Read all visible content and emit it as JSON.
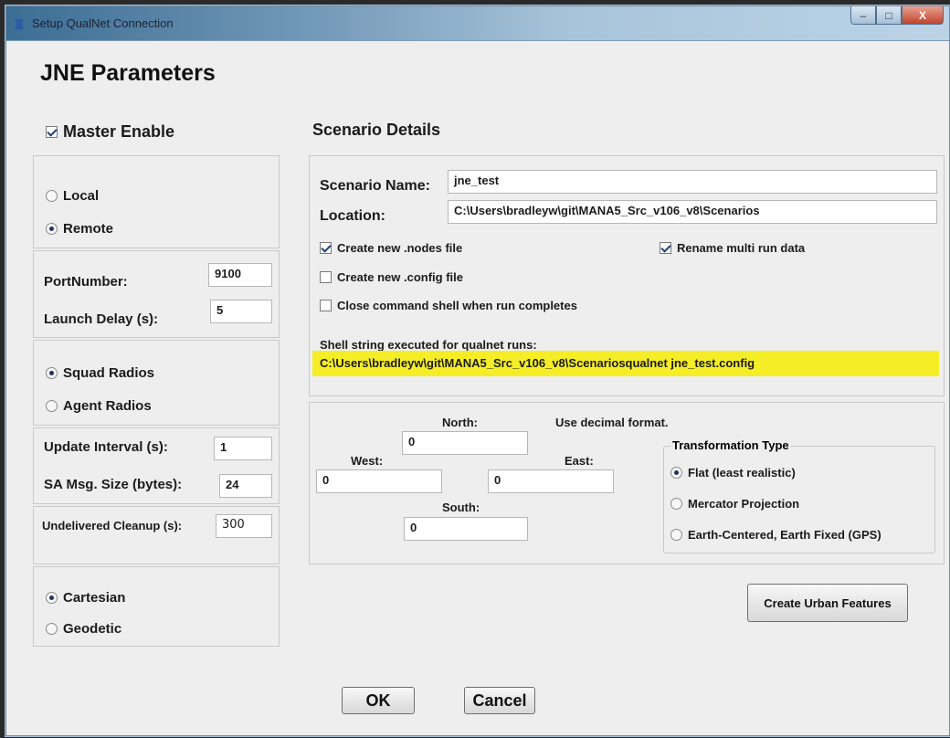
{
  "window": {
    "title": "Setup QualNet Connection",
    "min": "–",
    "max": "□",
    "close": "X"
  },
  "heading": "JNE Parameters",
  "left": {
    "master_enable": {
      "label": "Master Enable",
      "checked": true
    },
    "local": "Local",
    "remote": "Remote",
    "port_number": {
      "label": "PortNumber:",
      "value": "9100"
    },
    "launch_delay": {
      "label": "Launch Delay (s):",
      "value": "5"
    },
    "squad_radios": "Squad Radios",
    "agent_radios": "Agent Radios",
    "update_interval": {
      "label": "Update Interval (s):",
      "value": "1"
    },
    "sa_msg_size": {
      "label": "SA Msg. Size (bytes):",
      "value": "24"
    },
    "undelivered_cleanup": {
      "label": "Undelivered Cleanup (s):",
      "value": "300"
    },
    "cartesian": "Cartesian",
    "geodetic": "Geodetic"
  },
  "scenario": {
    "title": "Scenario Details",
    "name_label": "Scenario Name:",
    "name_value": "jne_test",
    "location_label": "Location:",
    "location_value": "C:\\Users\\bradleyw\\git\\MANA5_Src_v106_v8\\Scenarios",
    "create_nodes": "Create new .nodes file",
    "rename_multi": "Rename multi run data",
    "create_config": "Create new .config file",
    "close_shell": "Close command shell when run completes",
    "shell_label": "Shell string executed for qualnet runs:",
    "shell_value": "C:\\Users\\bradleyw\\git\\MANA5_Src_v106_v8\\Scenariosqualnet jne_test.config"
  },
  "bounds": {
    "north_label": "North:",
    "north": "0",
    "west_label": "West:",
    "west": "0",
    "east_label": "East:",
    "east": "0",
    "south_label": "South:",
    "south": "0",
    "note": "Use decimal format."
  },
  "transformation": {
    "title": "Transformation Type",
    "flat": "Flat (least realistic)",
    "mercator": "Mercator Projection",
    "ecef": "Earth-Centered, Earth Fixed (GPS)"
  },
  "buttons": {
    "urban": "Create Urban Features",
    "ok": "OK",
    "cancel": "Cancel"
  },
  "colors": {
    "highlight": "#f5ee26",
    "titlebar": "#3c6d93"
  }
}
